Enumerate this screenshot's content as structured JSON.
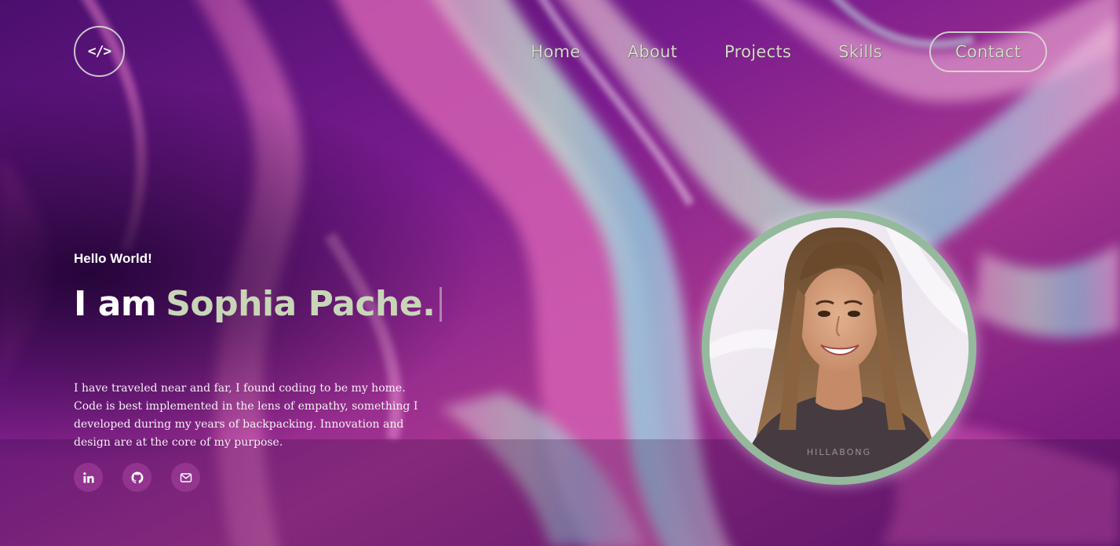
{
  "header": {
    "logo_text": "</>",
    "nav": [
      {
        "label": "Home"
      },
      {
        "label": "About"
      },
      {
        "label": "Projects"
      },
      {
        "label": "Skills"
      }
    ],
    "contact_label": "Contact"
  },
  "hero": {
    "greeting": "Hello World!",
    "headline_prefix": "I am",
    "headline_name": "Sophia Pache.",
    "bio": "I have traveled near and far, I found coding to be my home. Code is best implemented in the lens of empathy, something I developed during my years of backpacking. Innovation and design are at the core of my purpose.",
    "socials": [
      {
        "icon": "linkedin-icon"
      },
      {
        "icon": "github-icon"
      },
      {
        "icon": "mail-icon"
      }
    ]
  },
  "portrait": {
    "shirt_text": "HILLABONG",
    "ring_color": "#95b99c"
  },
  "colors": {
    "accent": "#c8d6b8",
    "background": "#3a0a5e"
  }
}
